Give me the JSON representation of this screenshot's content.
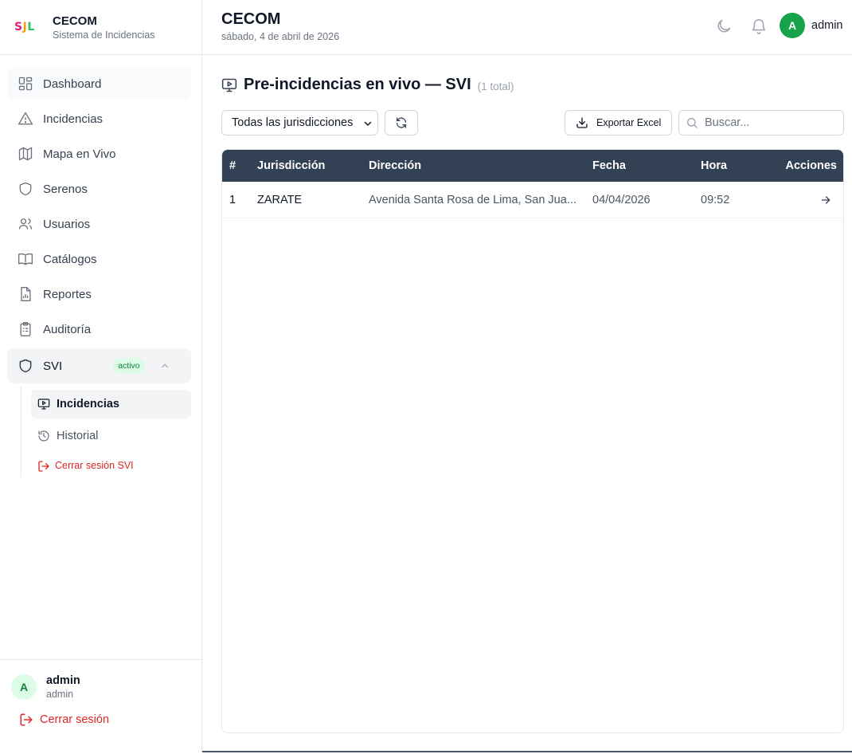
{
  "brand": {
    "logo": "SJL",
    "title": "CECOM",
    "subtitle": "Sistema de Incidencias"
  },
  "sidebar": {
    "items": [
      {
        "label": "Dashboard",
        "icon": "dashboard-icon"
      },
      {
        "label": "Incidencias",
        "icon": "alert-triangle-icon"
      },
      {
        "label": "Mapa en Vivo",
        "icon": "map-icon"
      },
      {
        "label": "Serenos",
        "icon": "shield-icon"
      },
      {
        "label": "Usuarios",
        "icon": "users-icon"
      },
      {
        "label": "Catálogos",
        "icon": "book-icon"
      },
      {
        "label": "Reportes",
        "icon": "report-icon"
      },
      {
        "label": "Auditoría",
        "icon": "clipboard-icon"
      }
    ],
    "svi": {
      "label": "SVI",
      "badge": "activo",
      "subitems": [
        {
          "label": "Incidencias",
          "icon": "monitor-play-icon"
        },
        {
          "label": "Historial",
          "icon": "history-icon"
        }
      ],
      "logout": "Cerrar sesión SVI"
    },
    "footer": {
      "avatar_letter": "A",
      "user_name": "admin",
      "user_role": "admin",
      "logout": "Cerrar sesión"
    }
  },
  "header": {
    "title": "CECOM",
    "date": "sábado, 4 de abril de 2026",
    "avatar_letter": "A",
    "user_name": "admin"
  },
  "main": {
    "page_title": "Pre-incidencias en vivo — SVI",
    "count": "(1 total)",
    "filter_selected": "Todas las jurisdicciones",
    "export_label": "Exportar Excel",
    "search_placeholder": "Buscar...",
    "table": {
      "columns": [
        "#",
        "Jurisdicción",
        "Dirección",
        "Fecha",
        "Hora",
        "Acciones"
      ],
      "rows": [
        {
          "num": "1",
          "jurisdiccion": "ZARATE",
          "direccion": "Avenida Santa Rosa de Lima, San Jua...",
          "fecha": "04/04/2026",
          "hora": "09:52"
        }
      ]
    }
  },
  "colors": {
    "table_header": "#334155",
    "accent_green": "#16a34a",
    "danger": "#dc2626"
  }
}
